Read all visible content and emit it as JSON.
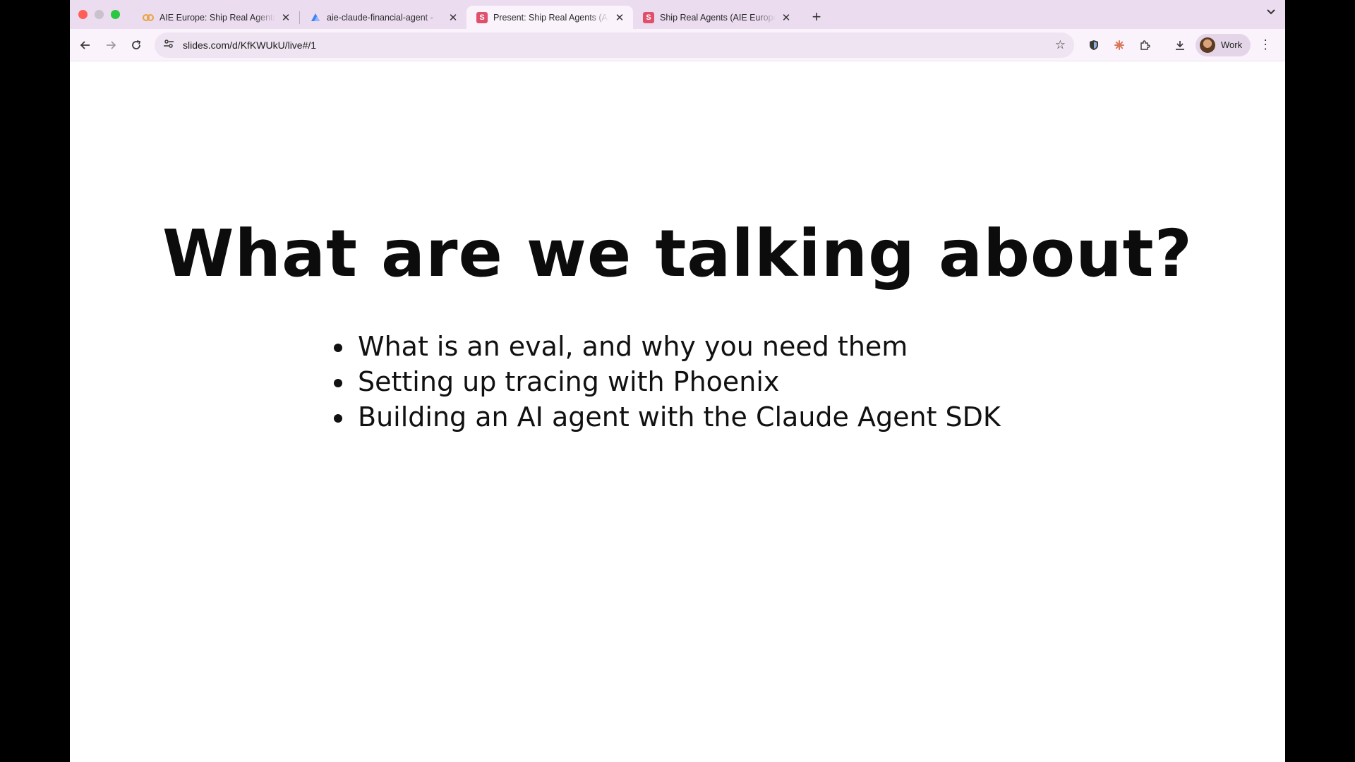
{
  "browser": {
    "tabs": [
      {
        "title": "AIE Europe: Ship Real Agents",
        "icon": "link-icon",
        "active": false
      },
      {
        "title": "aie-claude-financial-agent - ",
        "icon": "arize-icon",
        "active": false
      },
      {
        "title": "Present: Ship Real Agents (AI",
        "icon": "s",
        "active": true
      },
      {
        "title": "Ship Real Agents (AIE Europe",
        "icon": "s",
        "active": false
      }
    ],
    "address": "slides.com/d/KfKWUkU/live#/1",
    "profile_label": "Work",
    "new_tab_glyph": "+"
  },
  "slide": {
    "title": "What are we talking about?",
    "bullets": [
      "What is an eval, and why you need them",
      "Setting up tracing with Phoenix",
      "Building an AI agent with the Claude Agent SDK"
    ]
  },
  "colors": {
    "tabstrip_bg": "#ebdcef",
    "toolbar_bg": "#faf3fb",
    "favicon_slides": "#e0506b"
  }
}
